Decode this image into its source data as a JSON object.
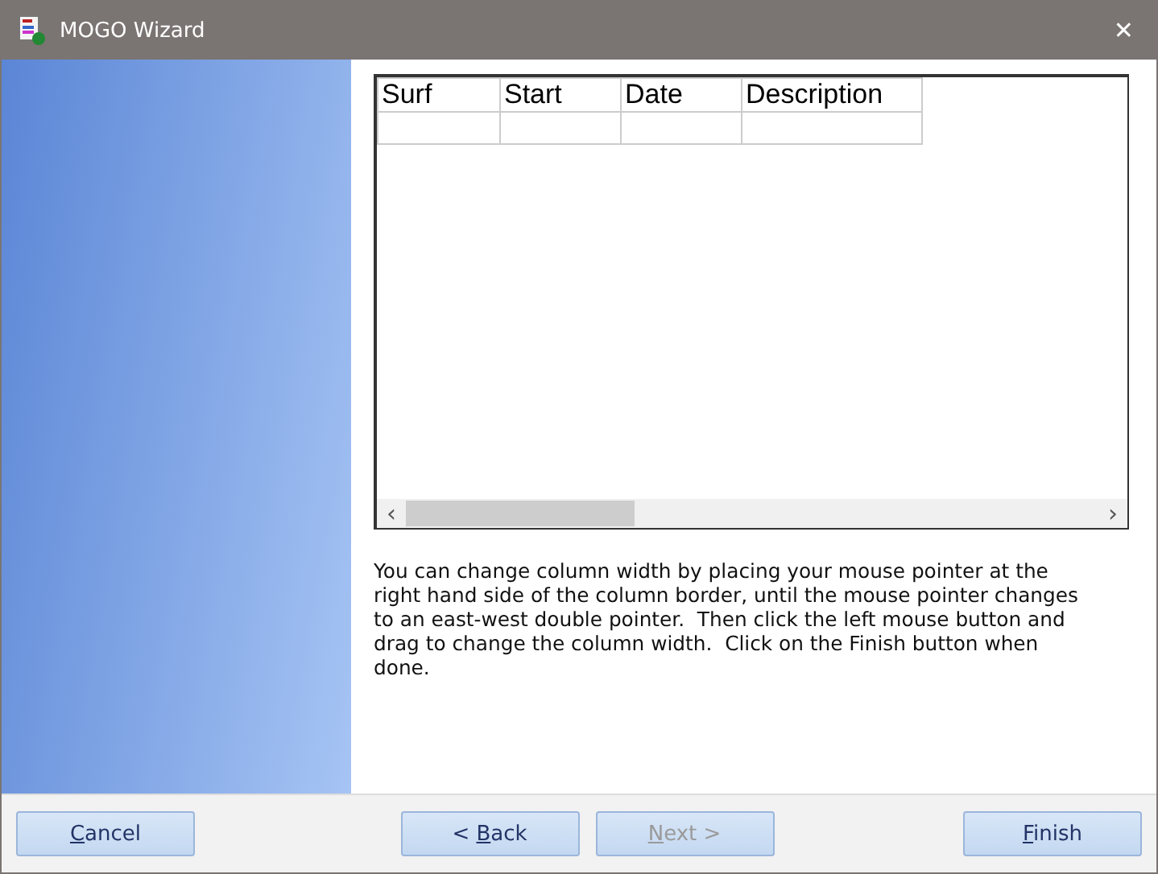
{
  "window": {
    "title": "MOGO Wizard",
    "close": "✕"
  },
  "grid": {
    "columns": [
      "Surf",
      "Start",
      "Date",
      "Description"
    ],
    "rows": [
      [
        "",
        "",
        "",
        ""
      ]
    ],
    "scroll_left": "‹",
    "scroll_right": "›"
  },
  "instructions": "You can change column width by placing your mouse pointer at the right hand side of the column border, until the mouse pointer changes to an east-west double pointer.  Then click the left mouse button and drag to change the column width.  Click on the Finish button when done.",
  "buttons": [
    {
      "key": "C",
      "post": "ancel",
      "disabled": false
    },
    {
      "pre": "< ",
      "key": "B",
      "post": "ack",
      "disabled": false
    },
    {
      "key": "N",
      "post": "ext >",
      "disabled": true
    },
    {
      "key": "F",
      "post": "inish",
      "disabled": false
    }
  ]
}
